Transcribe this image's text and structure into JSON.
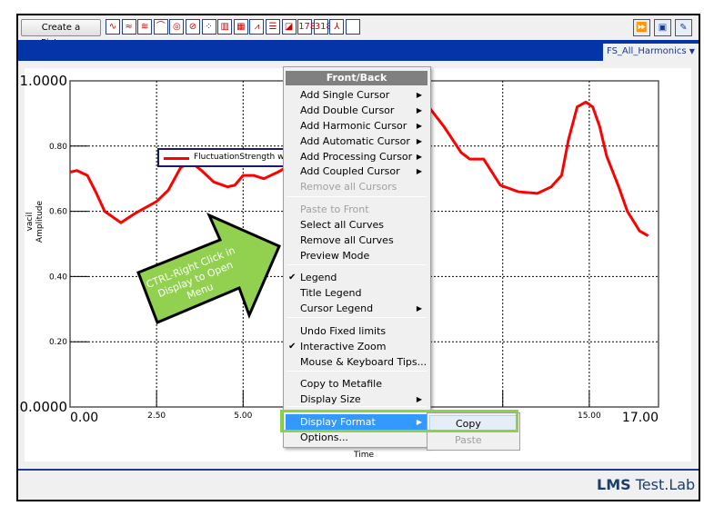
{
  "toolbar": {
    "create_picture_label": "Create a Picture...",
    "icons": [
      "line-display-icon",
      "double-line-icon",
      "stacked-line-icon",
      "overlay-icon",
      "polar-icon",
      "nyquist-icon",
      "scatter-icon",
      "bar-chart-icon",
      "colormap-icon",
      "waterfall-icon",
      "list-icon",
      "3d-icon",
      "numeric-display-icon",
      "table-display-icon",
      "axes-icon",
      "blank-icon"
    ],
    "icon_glyphs": [
      "∿",
      "≈",
      "≋",
      "⌒",
      "◎",
      "⊘",
      "⁘",
      "▥",
      "▦",
      "⩘",
      "☰",
      "◪",
      "178",
      "318",
      "⅄",
      ""
    ],
    "right_icons": [
      "play-forward-icon",
      "new-display-icon",
      "edit-icon"
    ],
    "right_glyphs": [
      "⏩",
      "▣",
      "✎"
    ]
  },
  "tab": {
    "label": "FS_All_Harmonics",
    "dropdown_glyph": "▼"
  },
  "chart_data": {
    "type": "line",
    "xlabel": "Time",
    "ylabel": "Amplitude",
    "yunit": "vacil",
    "xlim": [
      0,
      17
    ],
    "ylim": [
      0,
      1
    ],
    "grid": true,
    "x_ticks": [
      "0.00",
      "2.50",
      "5.00",
      "15.00",
      "17.00"
    ],
    "x_tick_values": [
      0,
      2.5,
      5,
      15,
      17
    ],
    "x_grid": [
      2.5,
      5,
      7.5,
      10,
      12.5,
      15
    ],
    "y_ticks": [
      "1.0000",
      "0.80",
      "0.60",
      "0.40",
      "0.20",
      "0.0000"
    ],
    "y_tick_values": [
      1,
      0.8,
      0.6,
      0.4,
      0.2,
      0
    ],
    "legend": {
      "entries": [
        "FluctuationStrength wh"
      ],
      "placement": "top-center"
    },
    "series": [
      {
        "name": "FluctuationStrength wh",
        "color": "#ff0000",
        "x": [
          0,
          0.2,
          0.5,
          0.74,
          1.0,
          1.47,
          1.9,
          2.5,
          2.84,
          3.2,
          3.5,
          3.8,
          4.15,
          4.55,
          4.76,
          5.0,
          5.3,
          5.6,
          6.0,
          7.0,
          8.0,
          9.0,
          10.0,
          10.4,
          10.8,
          11.3,
          11.55,
          11.95,
          12.43,
          12.95,
          13.5,
          13.9,
          14.2,
          14.4,
          14.65,
          14.9,
          15.1,
          15.3,
          15.5,
          15.85,
          16.1,
          16.45,
          16.7
        ],
        "y": [
          0.72,
          0.725,
          0.71,
          0.66,
          0.6,
          0.565,
          0.595,
          0.63,
          0.665,
          0.735,
          0.75,
          0.725,
          0.69,
          0.675,
          0.68,
          0.71,
          0.71,
          0.7,
          0.72,
          0.78,
          0.86,
          0.92,
          0.93,
          0.915,
          0.86,
          0.78,
          0.76,
          0.76,
          0.68,
          0.66,
          0.655,
          0.675,
          0.71,
          0.82,
          0.92,
          0.935,
          0.92,
          0.86,
          0.77,
          0.675,
          0.6,
          0.54,
          0.525
        ]
      }
    ]
  },
  "callout": {
    "text_lines": [
      "CTRL-Right Click in",
      "Display to Open",
      "Menu"
    ],
    "color": "#92d050"
  },
  "menu": {
    "header": "Front/Back",
    "items": [
      {
        "label": "Add Single Cursor",
        "submenu": true
      },
      {
        "label": "Add Double Cursor",
        "submenu": true
      },
      {
        "label": "Add Harmonic Cursor",
        "submenu": true
      },
      {
        "label": "Add Automatic Cursor",
        "submenu": true
      },
      {
        "label": "Add Processing Cursor",
        "submenu": true
      },
      {
        "label": "Add Coupled Cursor",
        "submenu": true
      },
      {
        "label": "Remove all Cursors",
        "disabled": true
      },
      {
        "label": "Paste to Front",
        "disabled": true
      },
      {
        "label": "Select all Curves"
      },
      {
        "label": "Remove all Curves"
      },
      {
        "label": "Preview Mode"
      },
      {
        "label": "Legend",
        "checked": true
      },
      {
        "label": "Title Legend"
      },
      {
        "label": "Cursor Legend",
        "submenu": true
      },
      {
        "label": "Undo Fixed limits"
      },
      {
        "label": "Interactive Zoom",
        "checked": true
      },
      {
        "label": "Mouse & Keyboard Tips..."
      },
      {
        "label": "Copy to Metafile"
      },
      {
        "label": "Display Size",
        "submenu": true
      },
      {
        "label": "Display Format",
        "submenu": true,
        "highlighted": true
      },
      {
        "label": "Options..."
      }
    ],
    "check_glyph": "✔",
    "submenu_glyph": "▶",
    "submenu": {
      "items": [
        {
          "label": "Copy"
        },
        {
          "label": "Paste",
          "disabled": true
        }
      ]
    }
  },
  "footer": {
    "brand_bold": "LMS",
    "brand_rest": " Test.Lab"
  },
  "colors": {
    "accent_blue": "#0533a8",
    "highlight": "#3399ff",
    "annotation_green": "#8cd14a"
  }
}
